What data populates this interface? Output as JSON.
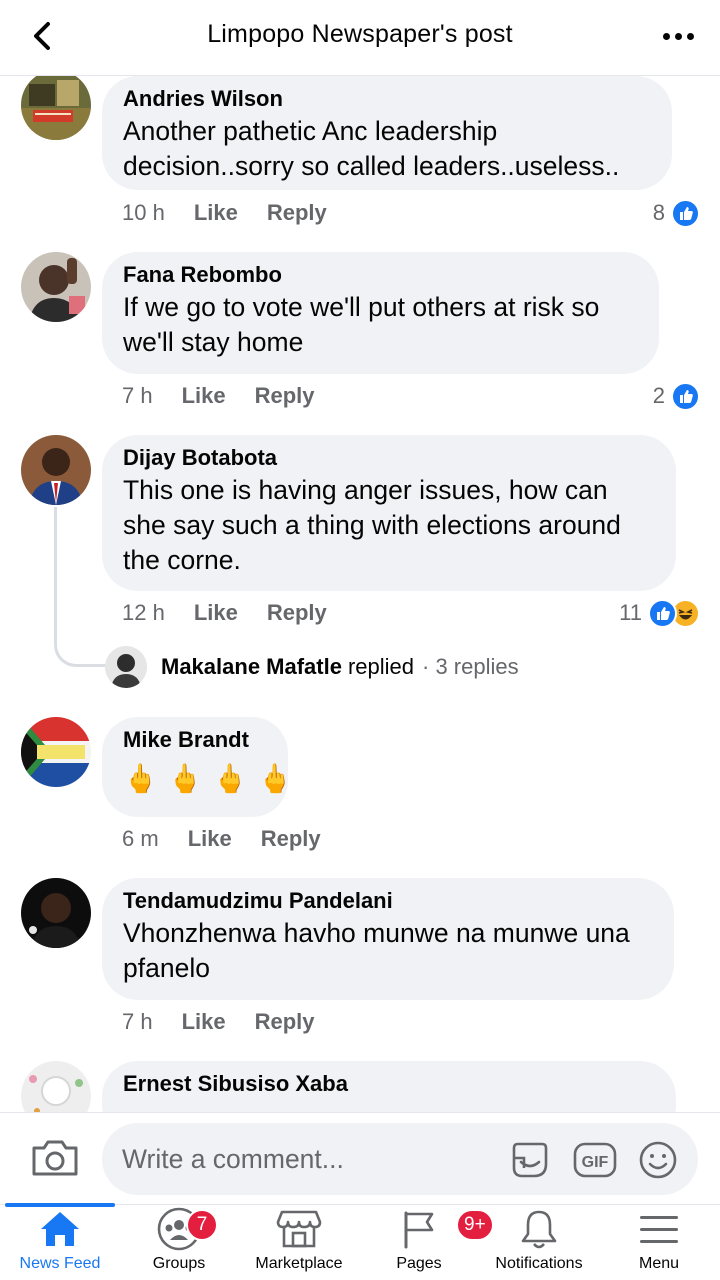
{
  "header": {
    "title": "Limpopo Newspaper's post"
  },
  "comments": [
    {
      "author": "Andries Wilson",
      "text": "Another pathetic Anc leadership decision..sorry so called leaders..useless..",
      "time": "10 h",
      "like": "Like",
      "reply": "Reply",
      "reactions": "8"
    },
    {
      "author": "Fana Rebombo",
      "text": "If we go to vote we'll put others at risk so we'll stay home",
      "time": "7 h",
      "like": "Like",
      "reply": "Reply",
      "reactions": "2"
    },
    {
      "author": "Dijay Botabota",
      "text": "This one is having anger issues, how can she say such a thing with elections around the corne.",
      "time": "12 h",
      "like": "Like",
      "reply": "Reply",
      "reactions": "11",
      "replies": {
        "name": "Makalane Mafatle",
        "verb": "replied",
        "count": "· 3 replies"
      }
    },
    {
      "author": "Mike Brandt",
      "emojis": [
        "🖕",
        "🖕",
        "🖕",
        "🖕"
      ],
      "time": "6 m",
      "like": "Like",
      "reply": "Reply"
    },
    {
      "author": "Tendamudzimu Pandelani",
      "text": "Vhonzhenwa havho munwe na munwe una pfanelo",
      "time": "7 h",
      "like": "Like",
      "reply": "Reply"
    },
    {
      "author": "Ernest Sibusiso Xaba"
    }
  ],
  "composer": {
    "placeholder": "Write a comment...",
    "gif_label": "GIF"
  },
  "tabs": [
    {
      "label": "News Feed",
      "icon": "home-icon"
    },
    {
      "label": "Groups",
      "icon": "groups-icon",
      "badge": "7"
    },
    {
      "label": "Marketplace",
      "icon": "marketplace-icon"
    },
    {
      "label": "Pages",
      "icon": "pages-flag-icon",
      "badge": "9+"
    },
    {
      "label": "Notifications",
      "icon": "bell-icon"
    },
    {
      "label": "Menu",
      "icon": "hamburger-icon"
    }
  ],
  "colors": {
    "accent": "#1877f2",
    "bubble": "#f0f2f5",
    "badge": "#e41e3f",
    "secondary_text": "#65676b"
  }
}
